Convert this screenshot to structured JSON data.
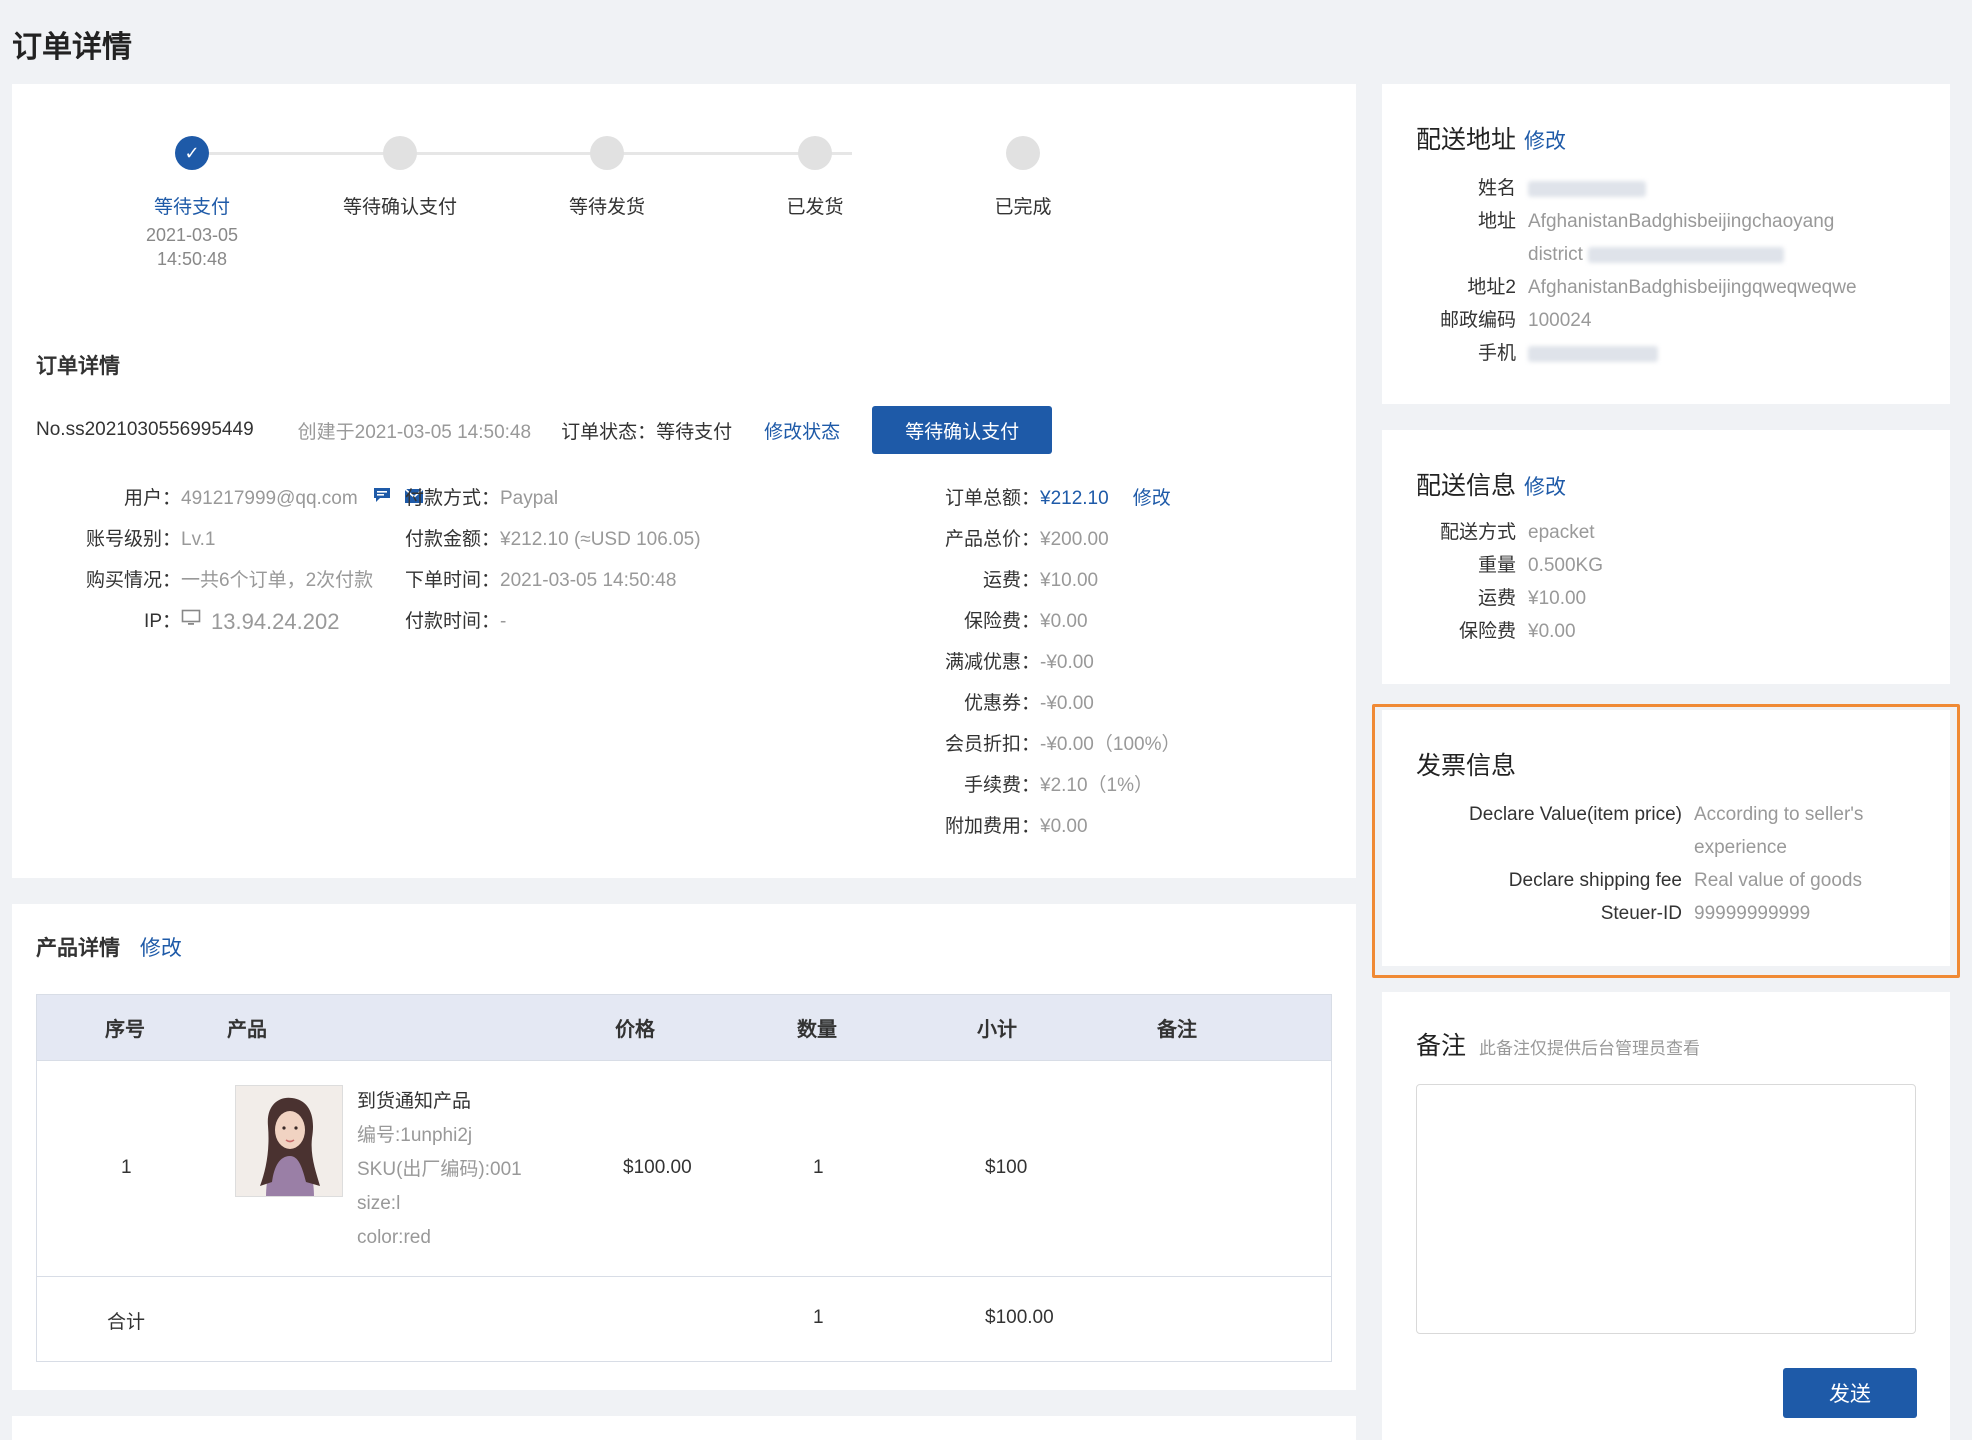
{
  "page_title": "订单详情",
  "steps": [
    {
      "label": "等待支付",
      "date": "2021-03-05",
      "time": "14:50:48",
      "active": true
    },
    {
      "label": "等待确认支付",
      "date": "",
      "time": "",
      "active": false
    },
    {
      "label": "等待发货",
      "date": "",
      "time": "",
      "active": false
    },
    {
      "label": "已发货",
      "date": "",
      "time": "",
      "active": false
    },
    {
      "label": "已完成",
      "date": "",
      "time": "",
      "active": false
    }
  ],
  "order": {
    "section_title": "订单详情",
    "number": "No.ss2021030556995449",
    "created": "创建于2021-03-05 14:50:48",
    "status_label": "订单状态：",
    "status_value": "等待支付",
    "modify_status": "修改状态",
    "status_button": "等待确认支付"
  },
  "customer": {
    "user_label": "用户：",
    "user_value": "491217999@qq.com",
    "level_label": "账号级别：",
    "level_value": "Lv.1",
    "purchase_label": "购买情况：",
    "purchase_value": "一共6个订单，2次付款",
    "ip_label": "IP：",
    "ip_value": "13.94.24.202"
  },
  "payment": {
    "method_label": "付款方式：",
    "method_value": "Paypal",
    "amount_label": "付款金额：",
    "amount_value": "¥212.10 (≈USD 106.05)",
    "order_time_label": "下单时间：",
    "order_time_value": "2021-03-05 14:50:48",
    "pay_time_label": "付款时间：",
    "pay_time_value": "-"
  },
  "totals": {
    "total_label": "订单总额：",
    "total_value": "¥212.10",
    "total_edit": "修改",
    "rows": [
      {
        "label": "产品总价：",
        "value": "¥200.00"
      },
      {
        "label": "运费：",
        "value": "¥10.00"
      },
      {
        "label": "保险费：",
        "value": "¥0.00"
      },
      {
        "label": "满减优惠：",
        "value": "-¥0.00"
      },
      {
        "label": "优惠券：",
        "value": "-¥0.00"
      },
      {
        "label": "会员折扣：",
        "value": "-¥0.00（100%）"
      },
      {
        "label": "手续费：",
        "value": "¥2.10（1%）"
      },
      {
        "label": "附加费用：",
        "value": "¥0.00"
      }
    ]
  },
  "products": {
    "section_title": "产品详情",
    "edit": "修改",
    "headers": [
      "序号",
      "产品",
      "价格",
      "数量",
      "小计",
      "备注"
    ],
    "row": {
      "index": "1",
      "name": "到货通知产品",
      "code": "编号:1unphi2j",
      "sku": "SKU(出厂编码):001",
      "size": "size:l",
      "color": "color:red",
      "price": "$100.00",
      "qty": "1",
      "subtotal": "$100",
      "note": ""
    },
    "footer": {
      "label": "合计",
      "qty": "1",
      "subtotal": "$100.00"
    }
  },
  "address": {
    "title": "配送地址",
    "edit": "修改",
    "name_label": "姓名",
    "address_label": "地址",
    "address_value": "AfghanistanBadghisbeijingchaoyang",
    "address_value_2": "district",
    "address2_label": "地址2",
    "address2_value": "AfghanistanBadghisbeijingqweqweqwe",
    "postcode_label": "邮政编码",
    "postcode_value": "100024",
    "phone_label": "手机"
  },
  "delivery": {
    "title": "配送信息",
    "edit": "修改",
    "rows": [
      {
        "label": "配送方式",
        "value": "epacket"
      },
      {
        "label": "重量",
        "value": "0.500KG"
      },
      {
        "label": "运费",
        "value": "¥10.00"
      },
      {
        "label": "保险费",
        "value": "¥0.00"
      }
    ]
  },
  "invoice": {
    "title": "发票信息",
    "declare_value_label": "Declare Value(item price)",
    "declare_value_value": "According to seller's",
    "declare_value_value_2": "experience",
    "shipping_label": "Declare shipping fee",
    "shipping_value": "Real value of goods",
    "steuer_label": "Steuer-ID",
    "steuer_value": "99999999999",
    "highlight_color": "#f08a35"
  },
  "remark": {
    "title": "备注",
    "hint": "此备注仅提供后台管理员查看",
    "placeholder": "",
    "send": "发送"
  },
  "colors": {
    "primary": "#1e5aa8",
    "background": "#f0f2f5"
  }
}
